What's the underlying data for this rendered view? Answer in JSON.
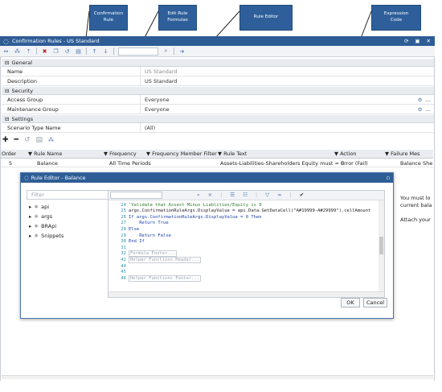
{
  "callouts": {
    "confirmation_rule": "Confirmation\nRule",
    "edit_rule_formulas": "Edit Rule\nFormulas",
    "rule_editor": "Rule Editor",
    "expression_code": "Expression\nCode"
  },
  "window": {
    "title": "Confirmation Rules - US Standard"
  },
  "general": {
    "header": "General",
    "name_label": "Name",
    "name_value": "US Standard",
    "description_label": "Description",
    "description_value": "US Standard"
  },
  "security": {
    "header": "Security",
    "access_label": "Access Group",
    "access_value": "Everyone",
    "maintenance_label": "Maintenance Group",
    "maintenance_value": "Everyone"
  },
  "settings": {
    "header": "Settings",
    "scenario_label": "Scenario Type Name",
    "scenario_value": "(All)"
  },
  "grid": {
    "headers": [
      "Order",
      "Rule Name",
      "Frequency",
      "Frequency Member Filter",
      "Rule Text",
      "Action",
      "Failure Mes"
    ],
    "row": [
      "5",
      "Balance",
      "All Time Periods",
      "",
      "Assets-Liabilities-Shareholders Equity must = 0",
      "Error (Fail)",
      "Balance She"
    ],
    "right_texts": [
      "You must lo",
      "current bala",
      "Attach your"
    ]
  },
  "dialog": {
    "title": "Rule Editor - Balance",
    "filter_placeholder": "Filter",
    "tree": [
      "api",
      "args",
      "BRApi",
      "Snippets"
    ],
    "ok": "OK",
    "cancel": "Cancel"
  },
  "code": [
    {
      "n": "24",
      "t": "'Validate that Assest Minus Liablities/Equity is 0",
      "c": "#2a7a2a"
    },
    {
      "n": "25",
      "t": "args.ConfirmationRuleArgs.DisplayValue = api.Data.GetDataCell(\"A#19999-A#29999\").cellAmount",
      "c": "#222"
    },
    {
      "n": "26",
      "t": "If args.ConfirmationRuleArgs.DisplayValue = 0 Then",
      "c": "#1b3fa6"
    },
    {
      "n": "27",
      "t": "    Return True",
      "c": "#1b3fa6"
    },
    {
      "n": "28",
      "t": "Else",
      "c": "#1b3fa6"
    },
    {
      "n": "29",
      "t": "    Return False",
      "c": "#1b3fa6"
    },
    {
      "n": "30",
      "t": "End If",
      "c": "#1b3fa6"
    },
    {
      "n": "31",
      "t": "",
      "c": "#222"
    },
    {
      "n": "32",
      "t": "Formula Footer...",
      "c": "#9aa3ae"
    },
    {
      "n": "42",
      "t": "Helper Functions Header...",
      "c": "#9aa3ae"
    },
    {
      "n": "44",
      "t": "",
      "c": "#222"
    },
    {
      "n": "45",
      "t": "",
      "c": "#222"
    },
    {
      "n": "46",
      "t": "Helper Functions Footer...",
      "c": "#9aa3ae"
    }
  ]
}
